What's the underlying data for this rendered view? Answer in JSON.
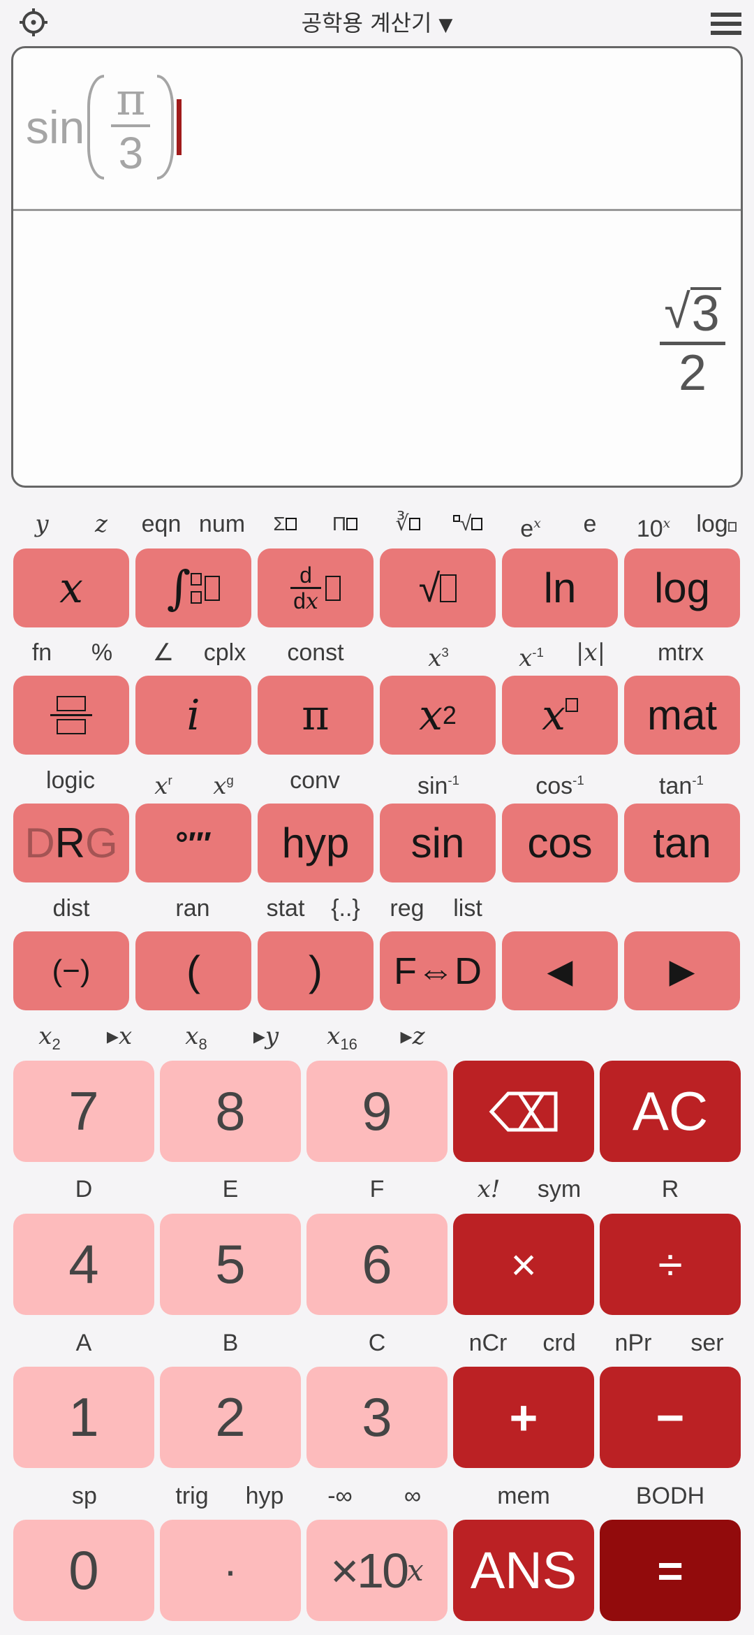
{
  "header": {
    "title": "공학용 계산기",
    "dropdown_caret": "▼",
    "settings_icon": "gear-icon",
    "menu_icon": "hamburger-menu-icon"
  },
  "display": {
    "input": {
      "function": "sin",
      "numerator": "π",
      "denominator": "3"
    },
    "result": {
      "radical": "√",
      "radicand": "3",
      "denominator": "2"
    }
  },
  "colors": {
    "sci_key": "#e97878",
    "num_key": "#fdbbbc",
    "op_key": "#bb2124",
    "equals_key": "#920b0c",
    "cursor": "#a01b1b"
  },
  "sci_rows": [
    {
      "labels": [
        "y",
        "z",
        "eqn",
        "num",
        "Σ□",
        "Π□",
        "∛□",
        "ⁿ√□",
        "eˣ",
        "e",
        "10ˣ",
        "log□"
      ],
      "keys": [
        "x",
        "∫",
        "d/dx",
        "√",
        "ln",
        "log"
      ]
    },
    {
      "labels": [
        "fn",
        "%",
        "∠",
        "cplx",
        "const",
        "x³",
        "x⁻¹",
        "|x|",
        "mtrx"
      ],
      "keys": [
        "fraction",
        "i",
        "π",
        "x²",
        "x□",
        "mat"
      ]
    },
    {
      "labels": [
        "logic",
        "xʳ",
        "xᵍ",
        "conv",
        "sin⁻¹",
        "cos⁻¹",
        "tan⁻¹"
      ],
      "keys": [
        "DRG",
        "°′″",
        "hyp",
        "sin",
        "cos",
        "tan"
      ]
    },
    {
      "labels": [
        "dist",
        "ran",
        "stat",
        "{..}",
        "reg",
        "list"
      ],
      "keys": [
        "(−)",
        "(",
        ")",
        "F⇔D",
        "◀",
        "▶"
      ]
    }
  ],
  "num_rows": [
    {
      "labels": [
        "x₂",
        "▸x",
        "x₈",
        "▸y",
        "x₁₆",
        "▸z"
      ],
      "keys": [
        "7",
        "8",
        "9",
        "backspace",
        "AC"
      ]
    },
    {
      "labels": [
        "D",
        "E",
        "F",
        "x!",
        "sym",
        "R"
      ],
      "keys": [
        "4",
        "5",
        "6",
        "×",
        "÷"
      ]
    },
    {
      "labels": [
        "A",
        "B",
        "C",
        "nCr",
        "crd",
        "nPr",
        "ser"
      ],
      "keys": [
        "1",
        "2",
        "3",
        "+",
        "−"
      ]
    },
    {
      "labels": [
        "sp",
        "trig",
        "hyp",
        "-∞",
        "∞",
        "mem",
        "BODH"
      ],
      "keys": [
        "0",
        "·",
        "×10ˣ",
        "ANS",
        "="
      ]
    }
  ],
  "labels_text": {
    "r0": {
      "y": "y",
      "z": "z",
      "eqn": "eqn",
      "num": "num",
      "sum": "Σ",
      "prod": "Π",
      "cbrt": "∛",
      "nrt": "√",
      "ex_base": "e",
      "ex_exp": "x",
      "e": "e",
      "tenx_base": "10",
      "tenx_exp": "x",
      "logb": "log"
    },
    "r1": {
      "fn": "fn",
      "pct": "%",
      "angle": "∠",
      "cplx": "cplx",
      "const": "const",
      "x3": "x",
      "x3e": "3",
      "xinv": "x",
      "xinve": "-1",
      "abs": "|x|",
      "mtrx": "mtrx"
    },
    "r2": {
      "logic": "logic",
      "xr": "x",
      "xre": "r",
      "xg": "x",
      "xge": "g",
      "conv": "conv",
      "asin": "sin",
      "acos": "cos",
      "atan": "tan",
      "inv": "-1"
    },
    "r3": {
      "dist": "dist",
      "ran": "ran",
      "stat": "stat",
      "set": "{..}",
      "reg": "reg",
      "list": "list"
    },
    "n0": {
      "x2": "x",
      "x2s": "2",
      "tox": "▸x",
      "x8": "x",
      "x8s": "8",
      "toy": "▸y",
      "x16": "x",
      "x16s": "16",
      "toz": "▸z"
    },
    "n1": {
      "D": "D",
      "E": "E",
      "F": "F",
      "fact": "x!",
      "sym": "sym",
      "R": "R"
    },
    "n2": {
      "A": "A",
      "B": "B",
      "C": "C",
      "ncr": "nCr",
      "crd": "crd",
      "npr": "nPr",
      "ser": "ser"
    },
    "n3": {
      "sp": "sp",
      "trig": "trig",
      "hyp": "hyp",
      "ninf": "-∞",
      "inf": "∞",
      "mem": "mem",
      "B": "B",
      "O": "O",
      "D": "D",
      "H": "H"
    }
  },
  "key_text": {
    "x": "x",
    "int": "∫",
    "d": "d",
    "dx_d": "d",
    "dx_x": "x",
    "sqrt": "√",
    "ln": "ln",
    "log": "log",
    "i": "i",
    "pi": "π",
    "x2": "x",
    "x2e": "2",
    "xn": "x",
    "mat": "mat",
    "drg_d": "D",
    "drg_r": "R",
    "drg_g": "G",
    "dms": "°′″",
    "hyp": "hyp",
    "sin": "sin",
    "cos": "cos",
    "tan": "tan",
    "neg": "(−)",
    "lp": "(",
    "rp": ")",
    "fd": "F⇔D",
    "left": "◀",
    "right": "▶",
    "k7": "7",
    "k8": "8",
    "k9": "9",
    "ac": "AC",
    "k4": "4",
    "k5": "5",
    "k6": "6",
    "mul": "×",
    "div": "÷",
    "k1": "1",
    "k2": "2",
    "k3": "3",
    "add": "+",
    "sub": "−",
    "k0": "0",
    "dot": "·",
    "exp_base": "×10",
    "exp_x": "x",
    "ans": "ANS",
    "eq": "="
  }
}
